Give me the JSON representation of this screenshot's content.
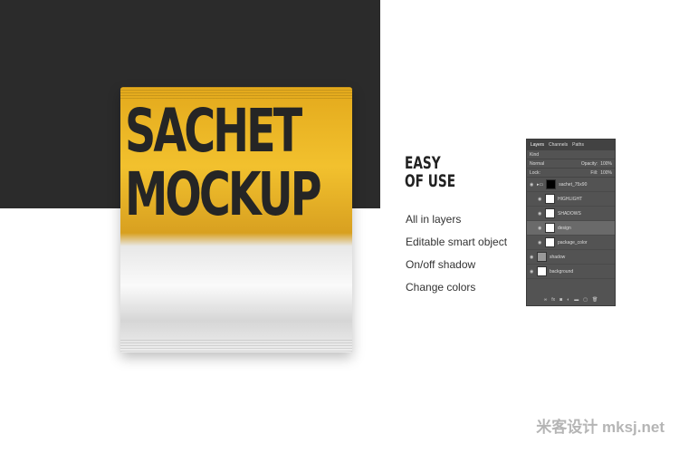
{
  "product": {
    "line1": "SACHET",
    "line2": "MOCKUP"
  },
  "features": {
    "heading_line1": "EASY",
    "heading_line2": "OF USE",
    "items": [
      "All in layers",
      "Editable smart object",
      "On/off shadow",
      "Change colors"
    ]
  },
  "layers_panel": {
    "tabs": [
      "Layers",
      "Channels",
      "Paths"
    ],
    "filter": "Kind",
    "blend_mode": "Normal",
    "opacity_label": "Opacity:",
    "opacity": "100%",
    "lock_label": "Lock:",
    "fill_label": "Fill:",
    "fill": "100%",
    "layers": [
      {
        "name": "sachet_75x90",
        "group": true
      },
      {
        "name": "HIGHLIGHT"
      },
      {
        "name": "SHADOWS"
      },
      {
        "name": "design",
        "selected": true
      },
      {
        "name": "package_color"
      },
      {
        "name": "shadow"
      },
      {
        "name": "background"
      }
    ]
  },
  "watermark": "米客设计 mksj.net",
  "colors": {
    "dark": "#2b2b2b",
    "yellow": "#f2c12e"
  }
}
